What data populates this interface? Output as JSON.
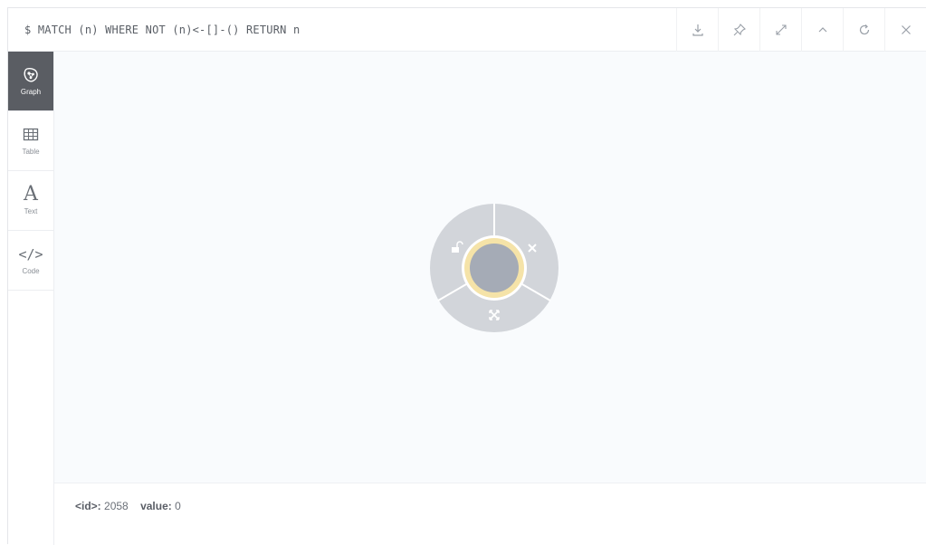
{
  "query": {
    "text": "$ MATCH (n) WHERE NOT (n)<-[]-() RETURN n"
  },
  "header_actions": [
    {
      "name": "download-icon"
    },
    {
      "name": "pin-icon"
    },
    {
      "name": "expand-icon"
    },
    {
      "name": "collapse-icon"
    },
    {
      "name": "rerun-icon"
    },
    {
      "name": "close-icon"
    }
  ],
  "sidebar": {
    "tabs": [
      {
        "label": "Graph",
        "icon": "graph-icon",
        "active": true
      },
      {
        "label": "Table",
        "icon": "table-icon",
        "active": false
      },
      {
        "label": "Text",
        "icon": "text-icon",
        "active": false
      },
      {
        "label": "Code",
        "icon": "code-icon",
        "active": false
      }
    ]
  },
  "graph": {
    "node": {
      "selected": true,
      "ring_actions": [
        "unlock-icon",
        "remove-icon",
        "expand-child-icon"
      ]
    }
  },
  "properties": {
    "id_key": "<id>:",
    "id_value": "2058",
    "value_key": "value:",
    "value_value": "0"
  },
  "colors": {
    "active_tab_bg": "#5a5d63",
    "node_fill": "#a5abb6",
    "node_ring": "#f5e3a8",
    "menu_fill": "#d2d5da",
    "canvas_bg": "#f9fbfd"
  }
}
